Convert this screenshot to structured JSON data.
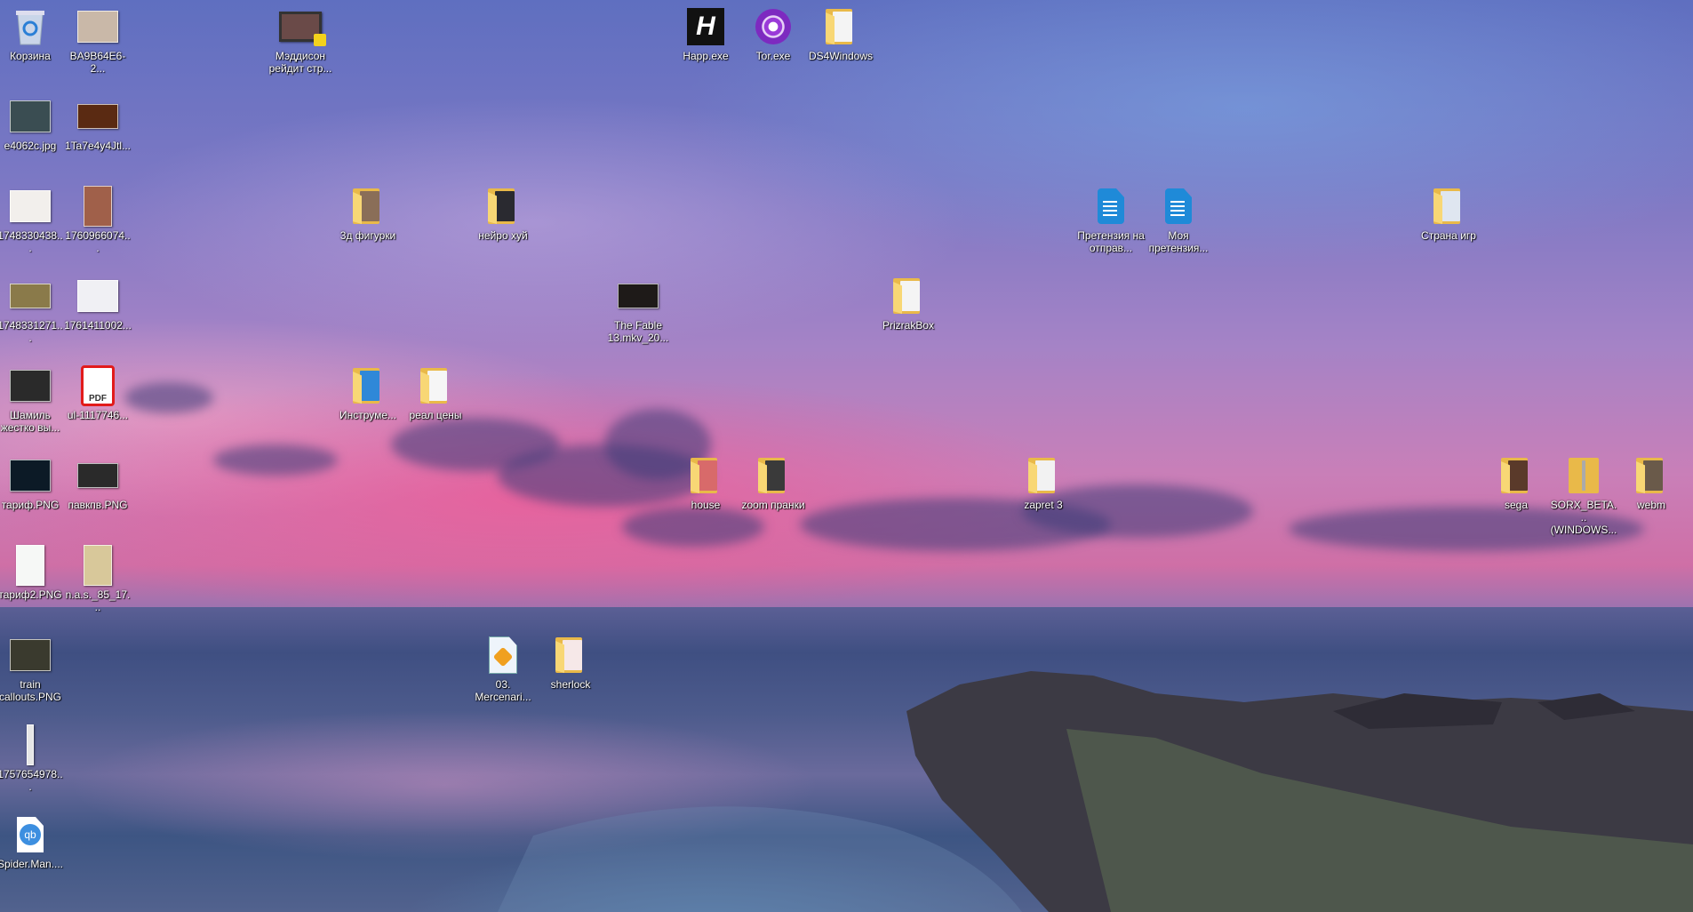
{
  "desktop": {
    "icons": [
      {
        "label": "Корзина",
        "icon": "recycle-bin-icon",
        "kind": "bin"
      },
      {
        "label": "BA9B64E6-2...",
        "icon": "image-thumbnail-icon",
        "kind": "image",
        "color": "#c9b8a8"
      },
      {
        "label": "Мэддисон рейдит стр...",
        "icon": "video-file-icon",
        "kind": "video",
        "color": "#6a4a48"
      },
      {
        "label": "Happ.exe",
        "icon": "happ-app-icon",
        "kind": "happ"
      },
      {
        "label": "Tor.exe",
        "icon": "tor-browser-icon",
        "kind": "tor"
      },
      {
        "label": "DS4Windows",
        "icon": "folder-icon",
        "kind": "folder",
        "color": "#f4f4f4"
      },
      {
        "label": "e4062c.jpg",
        "icon": "image-thumbnail-icon",
        "kind": "image",
        "color": "#3a4d52"
      },
      {
        "label": "1Ta7e4y4Jtl...",
        "icon": "image-thumbnail-icon",
        "kind": "imagewide",
        "color": "#5a2a12"
      },
      {
        "label": "1748330438...",
        "icon": "image-thumbnail-icon",
        "kind": "image",
        "color": "#f2efec"
      },
      {
        "label": "1760966074...",
        "icon": "image-thumbnail-icon",
        "kind": "imagetall",
        "color": "#a0604a"
      },
      {
        "label": "3д фигурки",
        "icon": "folder-icon",
        "kind": "folder",
        "color": "#8a6e58"
      },
      {
        "label": "нейро хуй",
        "icon": "folder-icon",
        "kind": "folder",
        "color": "#2a2a30"
      },
      {
        "label": "Претензия на отправ...",
        "icon": "document-icon",
        "kind": "bluedoc"
      },
      {
        "label": "Моя претензия...",
        "icon": "document-icon",
        "kind": "bluedoc"
      },
      {
        "label": "Страна игр",
        "icon": "folder-icon",
        "kind": "folder",
        "color": "#dfe6f0"
      },
      {
        "label": "1748331271...",
        "icon": "image-thumbnail-icon",
        "kind": "imagewide",
        "color": "#8a7a4a"
      },
      {
        "label": "1761411002...",
        "icon": "image-thumbnail-icon",
        "kind": "image",
        "color": "#f0f0f4"
      },
      {
        "label": "The Fable 13.mkv_20...",
        "icon": "image-thumbnail-icon",
        "kind": "imagewide",
        "color": "#1e1a18"
      },
      {
        "label": "PrizrakBox",
        "icon": "folder-icon",
        "kind": "folder",
        "color": "#f4f4f4"
      },
      {
        "label": "Шамиль жестко вы...",
        "icon": "image-shortcut-icon",
        "kind": "image",
        "color": "#2a2a2a"
      },
      {
        "label": "ul-1117746...",
        "icon": "pdf-icon",
        "kind": "pdf",
        "text": "PDF"
      },
      {
        "label": "Инструме...",
        "icon": "folder-icon",
        "kind": "folder",
        "color": "#2f88d8"
      },
      {
        "label": "реал цены",
        "icon": "folder-icon",
        "kind": "folder",
        "color": "#f6f6f6"
      },
      {
        "label": "тариф.PNG",
        "icon": "image-thumbnail-icon",
        "kind": "image",
        "color": "#0c1a26"
      },
      {
        "label": "павкпв.PNG",
        "icon": "image-thumbnail-icon",
        "kind": "imagewide",
        "color": "#2a2a2a"
      },
      {
        "label": "house",
        "icon": "folder-icon",
        "kind": "folder",
        "color": "#d86a6a"
      },
      {
        "label": "zoom пранки",
        "icon": "folder-icon",
        "kind": "folder",
        "color": "#3a3a3a"
      },
      {
        "label": "zapret 3",
        "icon": "folder-icon",
        "kind": "folder",
        "color": "#f2f2f2"
      },
      {
        "label": "sega",
        "icon": "folder-icon",
        "kind": "folder",
        "color": "#5a3a2a"
      },
      {
        "label": "SORX_BETA... (WINDOWS...",
        "icon": "zip-folder-icon",
        "kind": "zip"
      },
      {
        "label": "webm",
        "icon": "folder-icon",
        "kind": "folder",
        "color": "#6a5a4a"
      },
      {
        "label": "тариф2.PNG",
        "icon": "image-thumbnail-icon",
        "kind": "imagetall",
        "color": "#f6f8f6"
      },
      {
        "label": "n.a.s._85_17...",
        "icon": "image-thumbnail-icon",
        "kind": "imagetall",
        "color": "#d8c89a"
      },
      {
        "label": "train callouts.PNG",
        "icon": "image-thumbnail-icon",
        "kind": "image",
        "color": "#3a3a2e"
      },
      {
        "label": "03. Mercenari...",
        "icon": "winamp-audio-icon",
        "kind": "audio"
      },
      {
        "label": "sherlock",
        "icon": "folder-icon",
        "kind": "folder",
        "color": "#f6e8e8"
      },
      {
        "label": "1757654978...",
        "icon": "image-thumbnail-icon",
        "kind": "strip",
        "color": "#e6e6e6"
      },
      {
        "label": "Spider.Man....",
        "icon": "qbittorrent-file-icon",
        "kind": "qb",
        "text": "qb"
      }
    ]
  }
}
